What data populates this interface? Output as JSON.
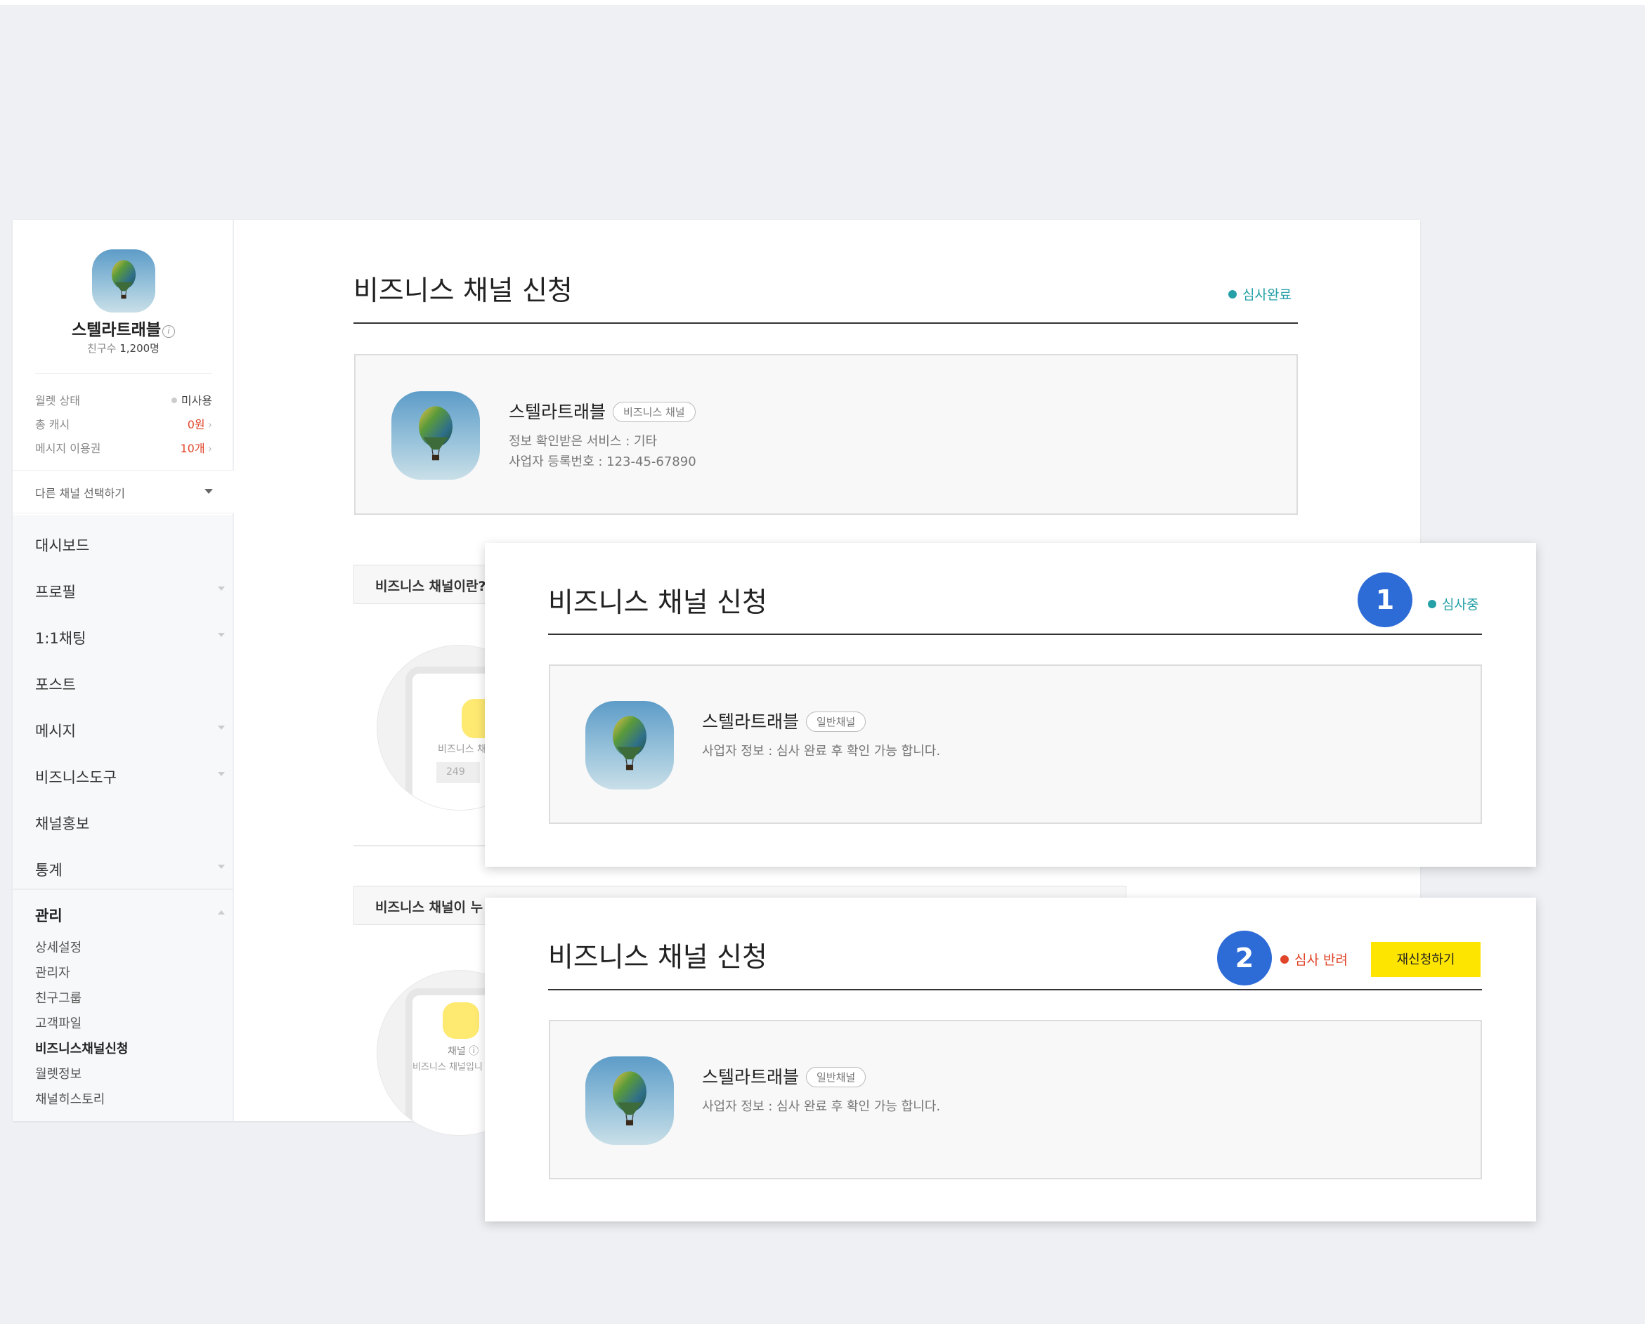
{
  "colors": {
    "accent_teal": "#26a0a7",
    "reject_red": "#e0452a",
    "badge_blue": "#2d6bd6",
    "reapply_yellow": "#fee500"
  },
  "sidebar": {
    "channel_name": "스텔라트래블",
    "friends_label": "친구수",
    "friends_count": "1,200명",
    "stats": [
      {
        "label": "월렛 상태",
        "value": "미사용"
      },
      {
        "label": "총 캐시",
        "value": "0원"
      },
      {
        "label": "메시지 이용권",
        "value": "10개"
      }
    ],
    "channel_select": "다른 채널 선택하기",
    "menu": [
      {
        "label": "대시보드"
      },
      {
        "label": "프로필"
      },
      {
        "label": "1:1채팅"
      },
      {
        "label": "포스트"
      },
      {
        "label": "메시지"
      },
      {
        "label": "비즈니스도구"
      },
      {
        "label": "채널홍보"
      },
      {
        "label": "통계"
      },
      {
        "label": "관리"
      }
    ],
    "submenu": [
      {
        "label": "상세설정"
      },
      {
        "label": "관리자"
      },
      {
        "label": "친구그룹"
      },
      {
        "label": "고객파일"
      },
      {
        "label": "비즈니스채널신청"
      },
      {
        "label": "월렛정보"
      },
      {
        "label": "채널히스토리"
      }
    ]
  },
  "main": {
    "title": "비즈니스 채널 신청",
    "status": "심사완료",
    "card": {
      "name": "스텔라트래블",
      "badge": "비즈니스 채널",
      "line1": "정보 확인받은 서비스 : 기타",
      "line2": "사업자 등록번호 : 123-45-67890"
    },
    "section1": "비즈니스 채널이란?",
    "section2": "비즈니스 채널이 누",
    "ill1_text": "비즈니스 채",
    "ill1_num": "249",
    "ill2_text": "채널",
    "ill2_sub": "비즈니스 채널입니"
  },
  "panel1": {
    "number": "1",
    "title": "비즈니스 채널 신청",
    "status": "심사중",
    "card": {
      "name": "스텔라트래블",
      "badge": "일반채널",
      "line1": "사업자 정보 : 심사 완료 후 확인 가능 합니다."
    }
  },
  "panel2": {
    "number": "2",
    "title": "비즈니스 채널 신청",
    "status": "심사 반려",
    "reapply": "재신청하기",
    "card": {
      "name": "스텔라트래블",
      "badge": "일반채널",
      "line1": "사업자 정보 : 심사 완료 후 확인 가능 합니다."
    }
  }
}
